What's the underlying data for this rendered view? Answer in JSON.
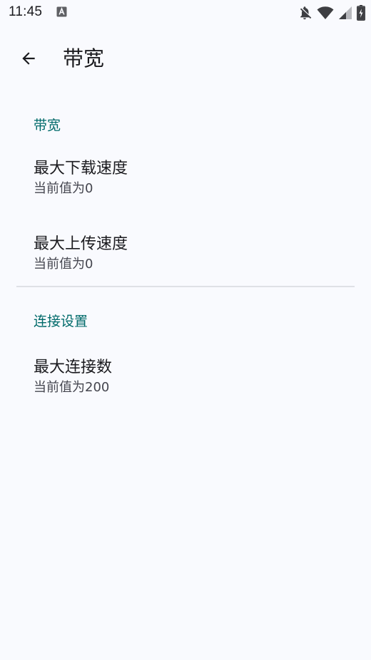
{
  "status_bar": {
    "time": "11:45",
    "icons": [
      "text-notification-icon",
      "notifications-off-icon",
      "wifi-icon",
      "cellular-signal-icon",
      "battery-charging-icon"
    ]
  },
  "toolbar": {
    "title": "带宽",
    "back_icon": "arrow-left-icon"
  },
  "categories": [
    {
      "title": "带宽",
      "items": [
        {
          "title": "最大下载速度",
          "summary": "当前值为0"
        },
        {
          "title": "最大上传速度",
          "summary": "当前值为0"
        }
      ]
    },
    {
      "title": "连接设置",
      "items": [
        {
          "title": "最大连接数",
          "summary": "当前值为200"
        }
      ]
    }
  ],
  "colors": {
    "background": "#f9fafe",
    "accent": "#006a6a",
    "text_primary": "#1b1b1f",
    "text_secondary": "#45464f",
    "divider": "#dfe1e6"
  }
}
